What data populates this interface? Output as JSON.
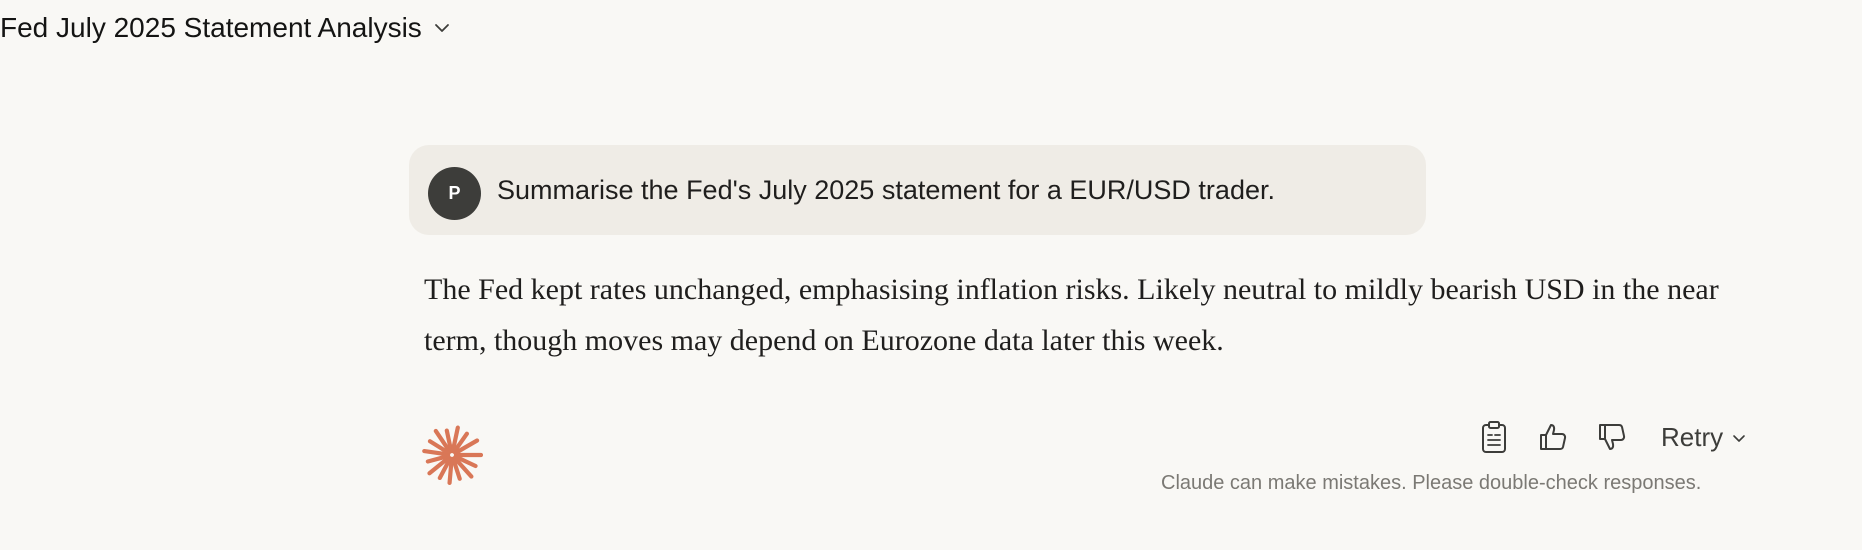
{
  "header": {
    "title": "Fed July 2025 Statement Analysis",
    "dropdown_icon": "chevron-down-icon"
  },
  "user_message": {
    "avatar_initial": "P",
    "text": "Summarise the Fed's July 2025 statement for a EUR/USD trader."
  },
  "assistant_message": {
    "text": "The Fed kept rates unchanged, emphasising inflation risks. Likely neutral to mildly bearish USD in the near term, though moves may depend on Eurozone data later this week.",
    "logo_icon": "claude-sparkle-icon",
    "logo_color": "#d97757"
  },
  "actions": {
    "copy_icon": "clipboard-icon",
    "thumbs_up_icon": "thumbs-up-icon",
    "thumbs_down_icon": "thumbs-down-icon",
    "retry_label": "Retry",
    "retry_icon": "chevron-down-icon"
  },
  "disclaimer": "Claude can make mistakes. Please double-check responses.",
  "colors": {
    "background": "#f9f8f5",
    "user_bubble": "#efece6",
    "avatar": "#3d3d3a",
    "accent": "#d97757"
  }
}
